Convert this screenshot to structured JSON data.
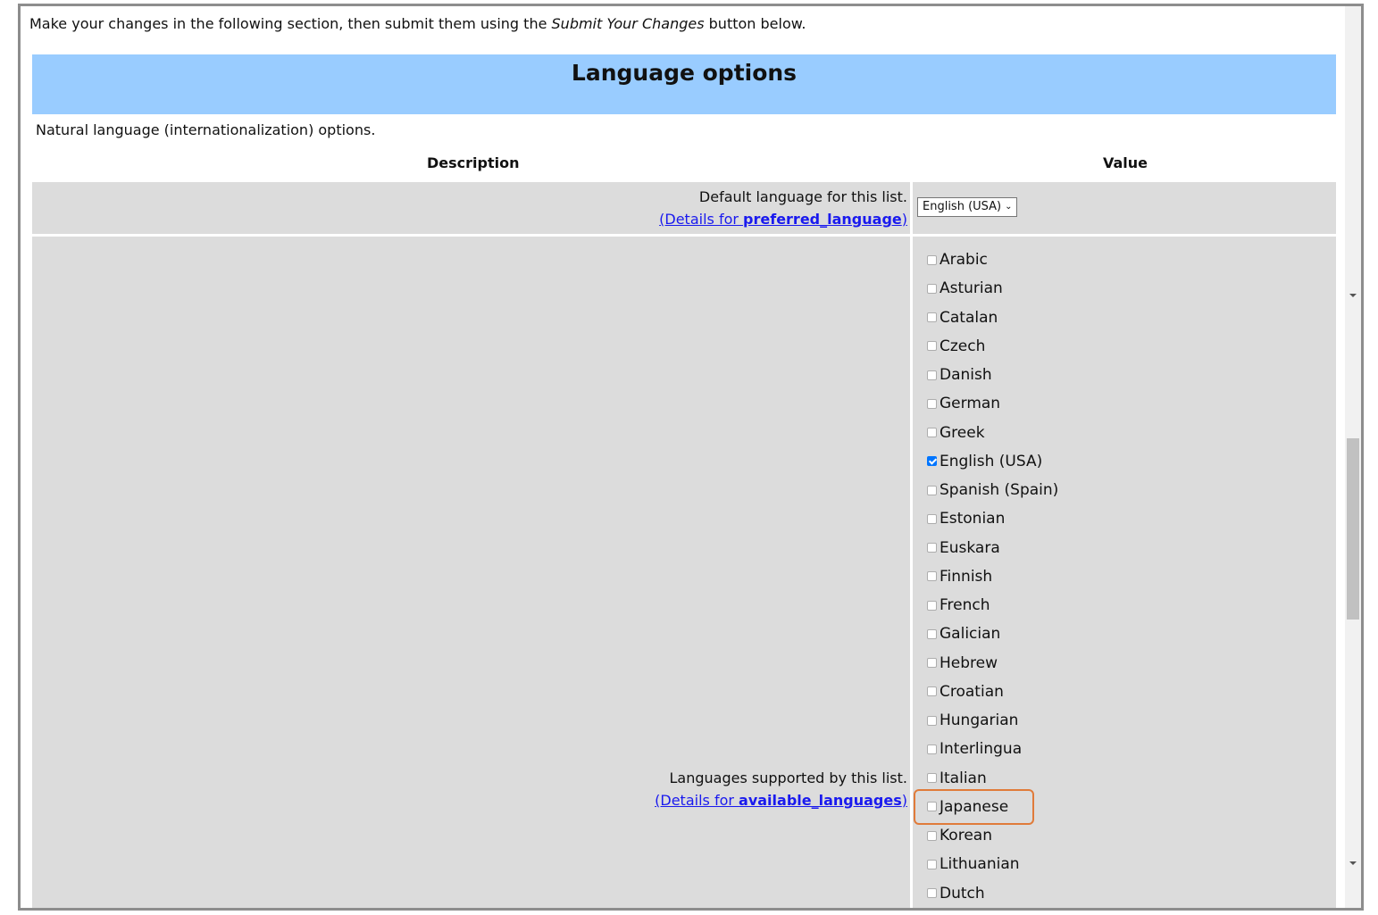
{
  "intro": {
    "prefix": "Make your changes in the following section, then submit them using the ",
    "emphasis": "Submit Your Changes",
    "suffix": " button below."
  },
  "banner_title": "Language options",
  "subtitle": "Natural language (internationalization) options.",
  "table": {
    "col_description": "Description",
    "col_value": "Value",
    "rows": {
      "preferred": {
        "label": "Default language for this list.",
        "details_prefix": "(Details for ",
        "details_bold": "preferred_language",
        "details_suffix": ")",
        "select_value": "English (USA)"
      },
      "available": {
        "label": "Languages supported by this list.",
        "details_prefix": "(Details for ",
        "details_bold": "available_languages",
        "details_suffix": ")"
      }
    }
  },
  "languages": [
    {
      "label": "Arabic",
      "checked": false
    },
    {
      "label": "Asturian",
      "checked": false
    },
    {
      "label": "Catalan",
      "checked": false
    },
    {
      "label": "Czech",
      "checked": false
    },
    {
      "label": "Danish",
      "checked": false
    },
    {
      "label": "German",
      "checked": false
    },
    {
      "label": "Greek",
      "checked": false
    },
    {
      "label": "English (USA)",
      "checked": true
    },
    {
      "label": "Spanish (Spain)",
      "checked": false
    },
    {
      "label": "Estonian",
      "checked": false
    },
    {
      "label": "Euskara",
      "checked": false
    },
    {
      "label": "Finnish",
      "checked": false
    },
    {
      "label": "French",
      "checked": false
    },
    {
      "label": "Galician",
      "checked": false
    },
    {
      "label": "Hebrew",
      "checked": false
    },
    {
      "label": "Croatian",
      "checked": false
    },
    {
      "label": "Hungarian",
      "checked": false
    },
    {
      "label": "Interlingua",
      "checked": false
    },
    {
      "label": "Italian",
      "checked": false
    },
    {
      "label": "Japanese",
      "checked": false,
      "highlighted": true
    },
    {
      "label": "Korean",
      "checked": false
    },
    {
      "label": "Lithuanian",
      "checked": false
    },
    {
      "label": "Dutch",
      "checked": false
    }
  ],
  "colors": {
    "banner": "#99ccff",
    "cell_bg": "#dcdcdc",
    "link": "#1a1aee",
    "highlight": "#e07b3a",
    "checkbox_checked": "#0075ff"
  }
}
